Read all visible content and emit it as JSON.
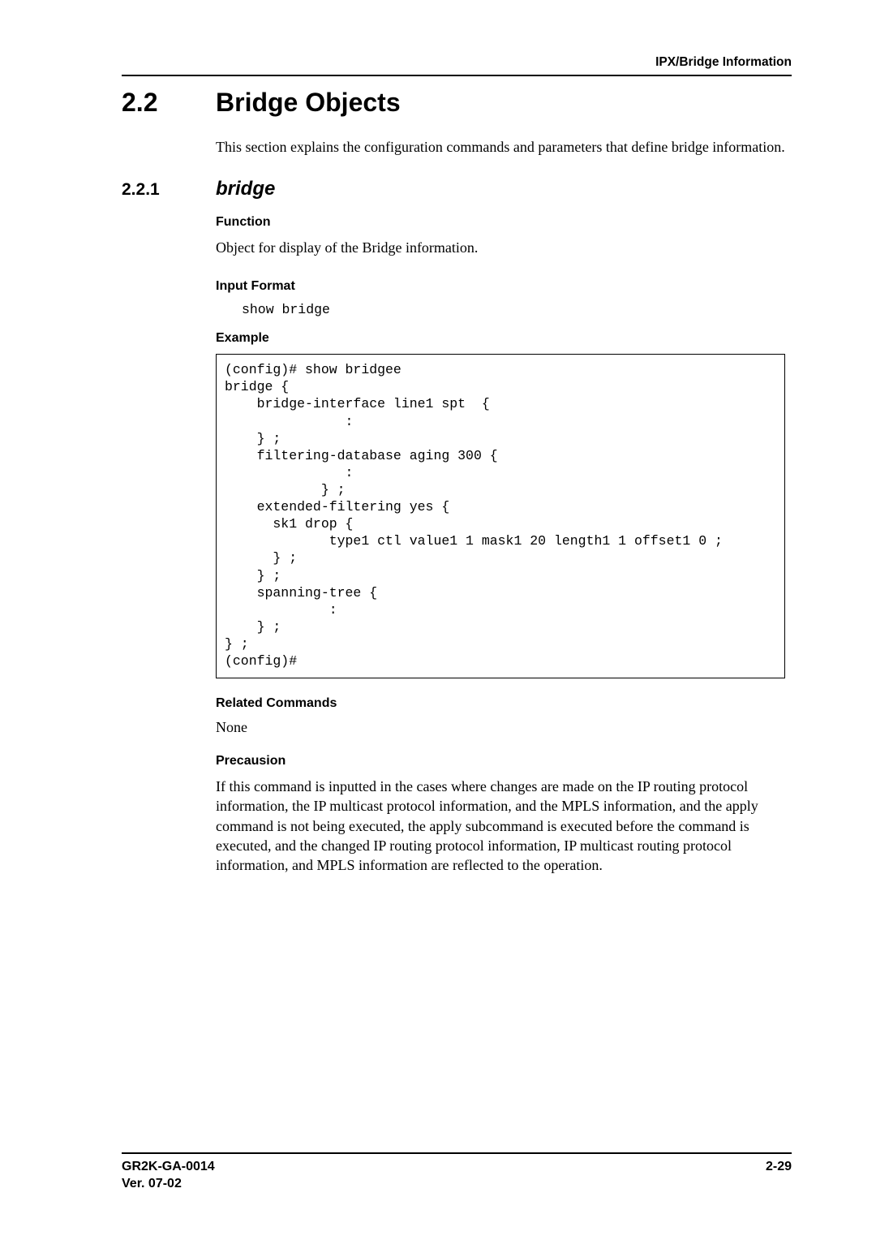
{
  "running_head": "IPX/Bridge Information",
  "h1": {
    "num": "2.2",
    "title": "Bridge Objects"
  },
  "intro": "This section explains the configuration commands and parameters that define bridge information.",
  "h2": {
    "num": "2.2.1",
    "title": "bridge"
  },
  "labels": {
    "function": "Function",
    "input_format": "Input Format",
    "example": "Example",
    "related": "Related Commands",
    "precaution": "Precausion"
  },
  "function_text": "Object for display of the Bridge information.",
  "input_format_code": "show bridge",
  "example_code": "(config)# show bridgee\nbridge {\n    bridge-interface line1 spt  {\n               :\n    } ;\n    filtering-database aging 300 {\n               :\n            } ;\n    extended-filtering yes {\n      sk1 drop {\n             type1 ctl value1 1 mask1 20 length1 1 offset1 0 ;\n      } ;\n    } ;\n    spanning-tree {\n             :\n    } ;\n} ;\n(config)#",
  "related_text": "None",
  "precaution_text": "If this command is inputted in the cases where changes are made on the IP routing protocol information, the IP multicast protocol information, and the MPLS information, and the apply command is not being executed, the apply subcommand is executed before the command is executed, and the changed IP routing protocol information, IP multicast routing protocol information, and MPLS information are reflected to the operation.",
  "footer": {
    "doc_id": "GR2K-GA-0014",
    "version": "Ver. 07-02",
    "page": "2-29"
  }
}
